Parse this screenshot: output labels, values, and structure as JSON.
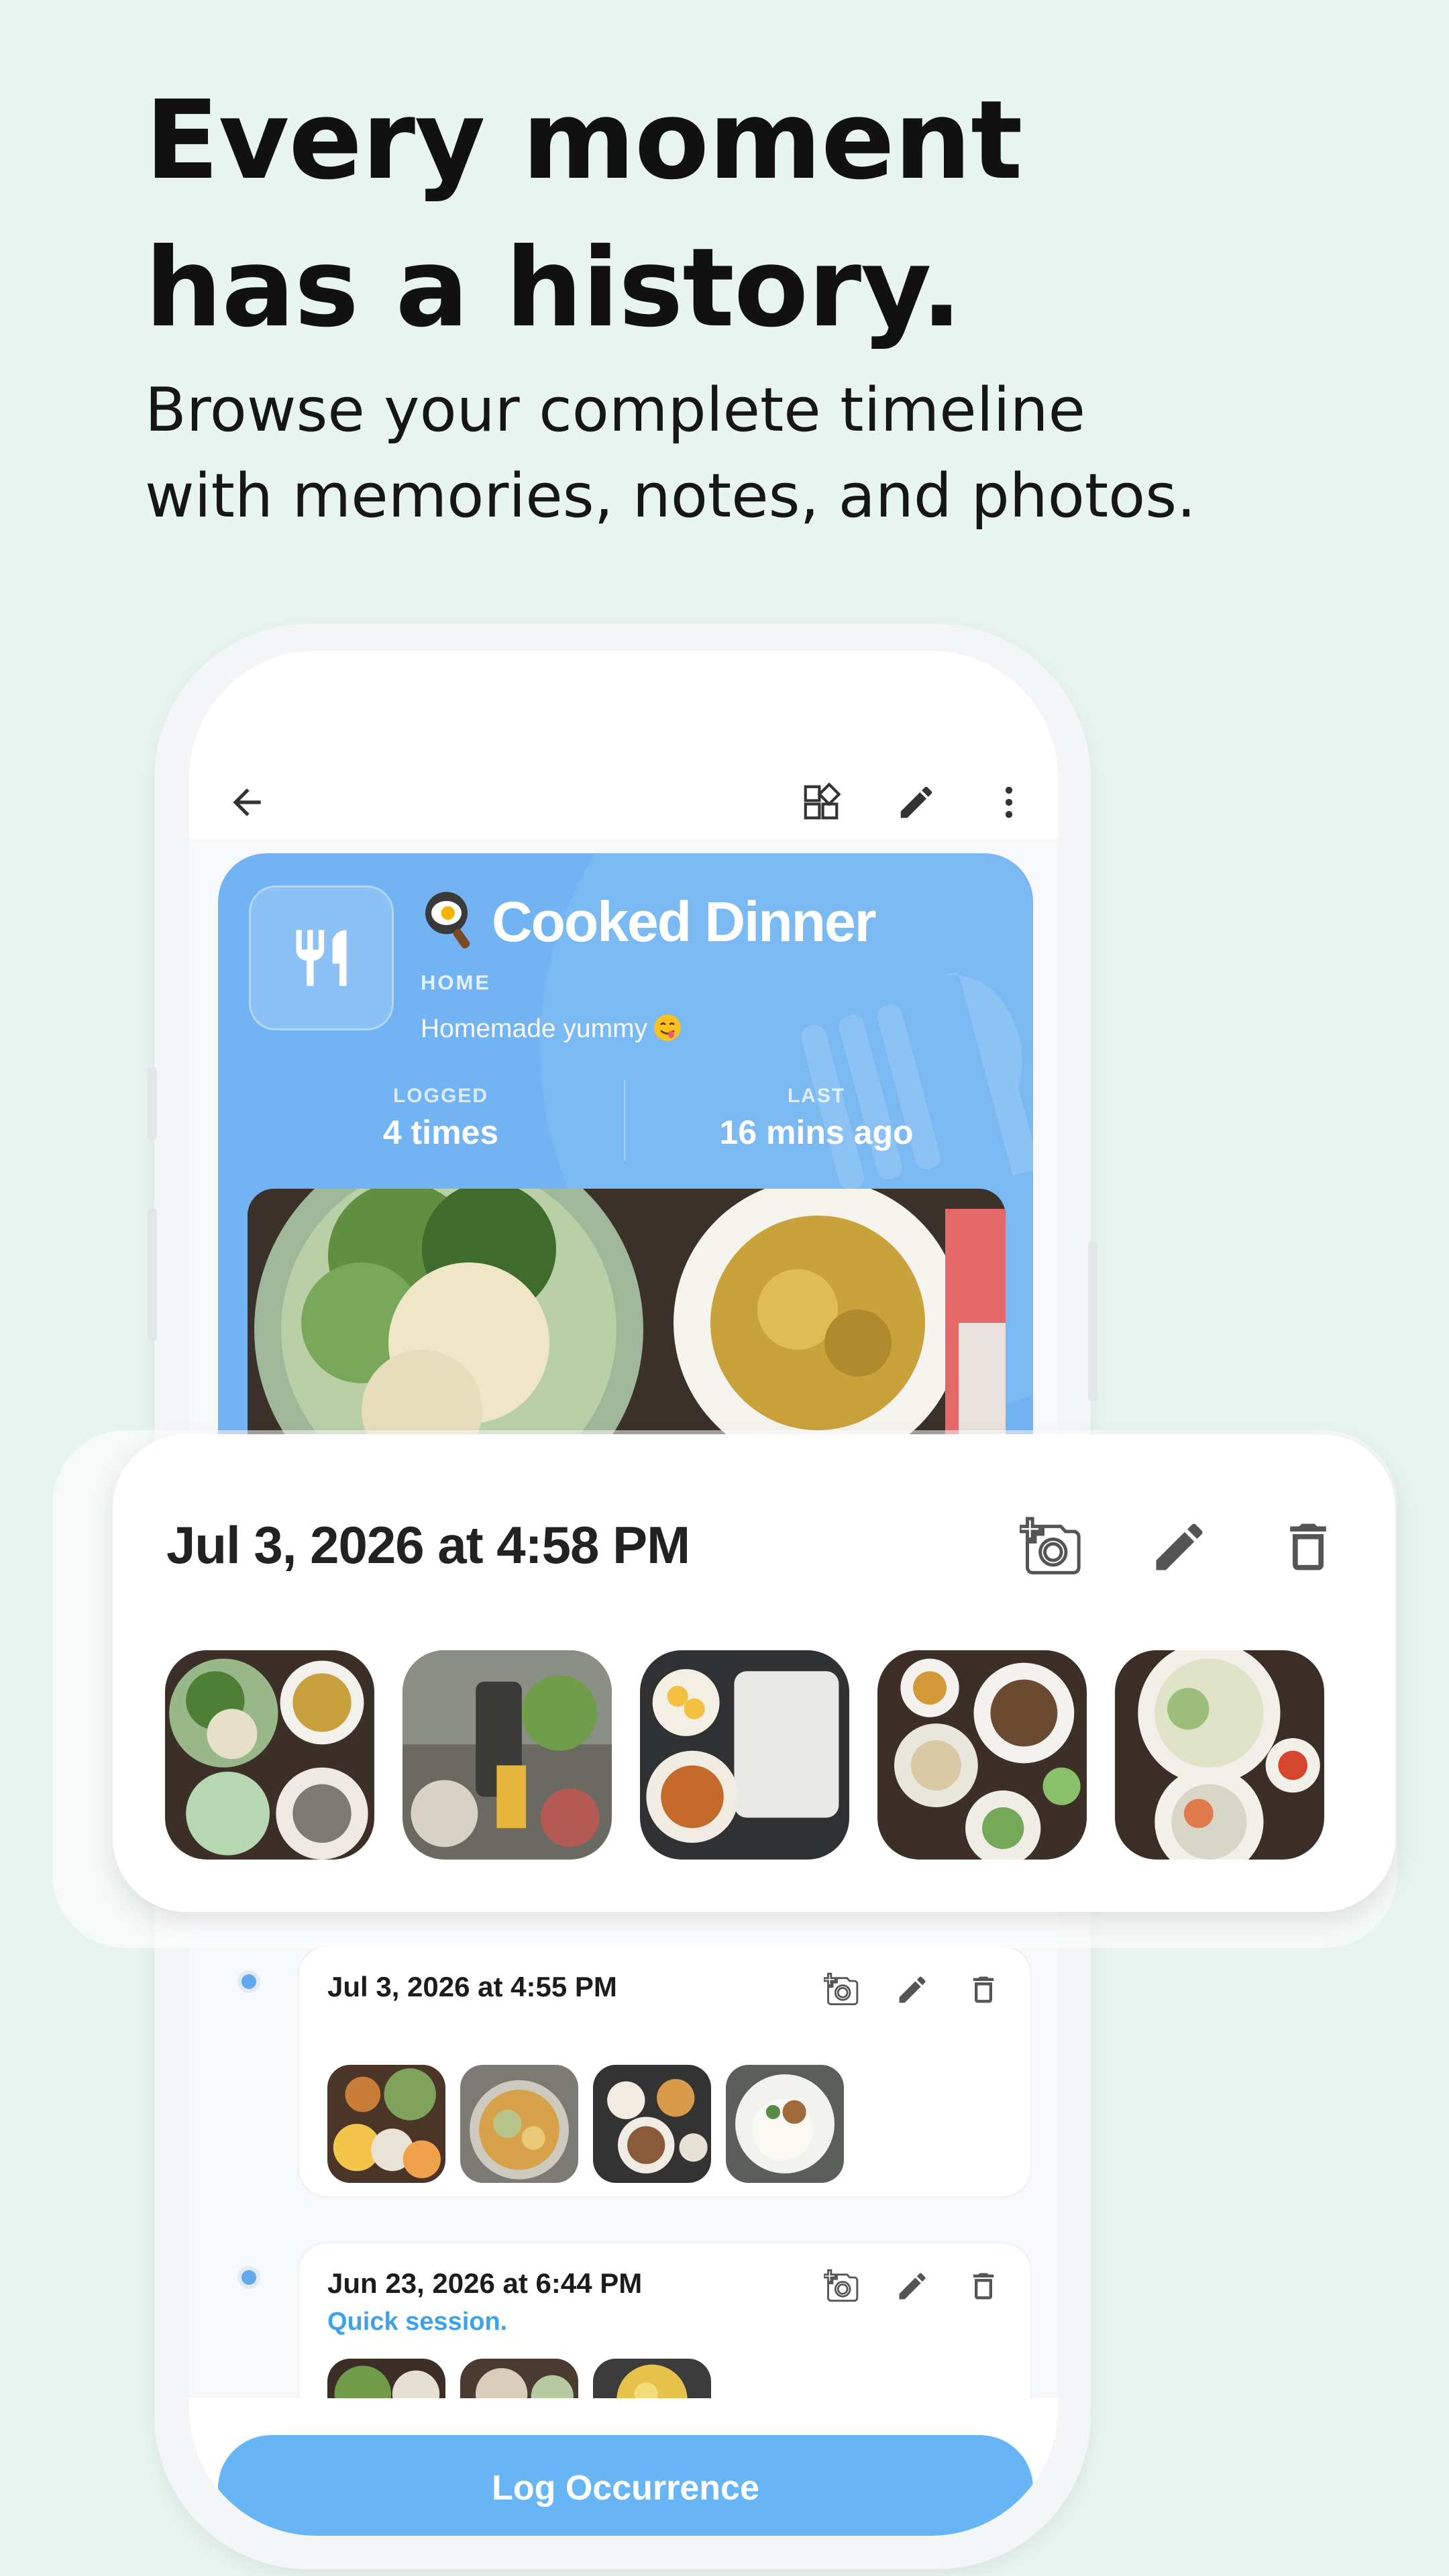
{
  "promo": {
    "headline_line1": "Every moment",
    "headline_line2": "has a history.",
    "subhead_line1": "Browse your complete timeline",
    "subhead_line2": "with memories, notes, and photos."
  },
  "topbar": {
    "back_icon": "arrow-left-icon",
    "widgets_icon": "widgets-icon",
    "edit_icon": "pencil-icon",
    "more_icon": "more-vert-icon"
  },
  "hero": {
    "emoji": "frying-pan-egg",
    "title": "Cooked Dinner",
    "category": "HOME",
    "description": "Homemade yummy",
    "description_emoji": "face-savoring-food",
    "stats": [
      {
        "label": "LOGGED",
        "value": "4 times"
      },
      {
        "label": "LAST",
        "value": "16 mins ago"
      }
    ],
    "icon": "fork-knife-icon",
    "accent_color": "#72b4f3"
  },
  "highlight": {
    "date": "Jul 3, 2026 at 4:58 PM",
    "photo_count": 5
  },
  "timeline": [
    {
      "date": "Jul 3, 2026 at 4:55 PM",
      "note": "",
      "photo_count": 4
    },
    {
      "date": "Jun 23, 2026 at 6:44 PM",
      "note": "Quick session.",
      "photo_count": 3
    }
  ],
  "actions": {
    "add_photo_icon": "add-photo-icon",
    "edit_icon": "pencil-icon",
    "delete_icon": "trash-icon"
  },
  "log_button": {
    "label": "Log Occurrence"
  },
  "colors": {
    "background": "#e8f4ef",
    "accent": "#68b5f5",
    "note_text": "#3ea1ea"
  }
}
